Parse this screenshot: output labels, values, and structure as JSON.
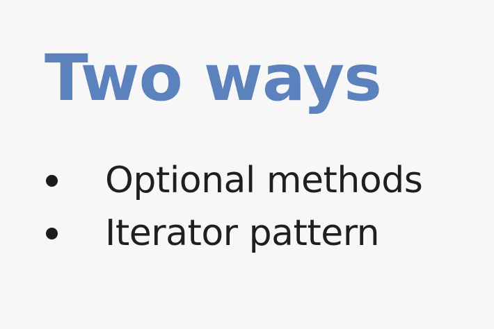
{
  "slide": {
    "title": "Two ways",
    "bullets": [
      {
        "label": "Optional methods"
      },
      {
        "label": "Iterator pattern"
      }
    ]
  },
  "colors": {
    "title": "#5b82bd",
    "text": "#1f1f1f",
    "background": "#f7f7f7"
  }
}
